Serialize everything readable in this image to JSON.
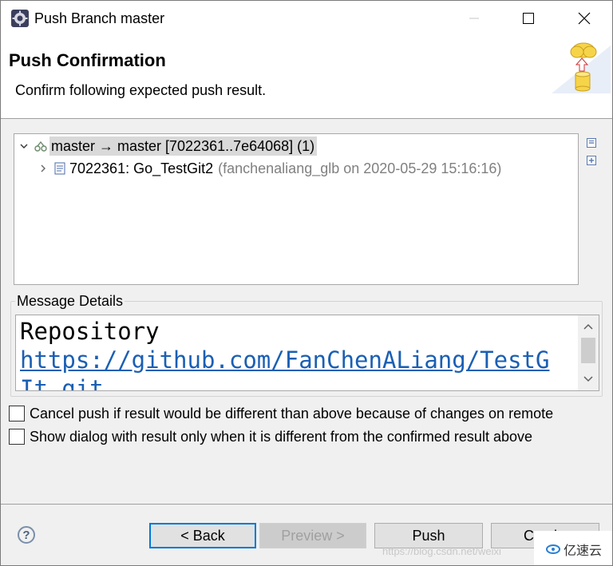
{
  "window": {
    "title": "Push Branch master"
  },
  "header": {
    "title": "Push Confirmation",
    "description": "Confirm following expected push result."
  },
  "tree": {
    "ref_update": "master → master [7022361..7e64068] (1)",
    "commit": {
      "label": "7022361: Go_TestGit2",
      "meta": "(fanchenaliang_glb on 2020-05-29 15:16:16)"
    }
  },
  "message_details": {
    "label": "Message Details",
    "line1": "Repository",
    "line2": "https://github.com/FanChenALiang/TestG",
    "line3": "It.git"
  },
  "options": [
    {
      "label": "Cancel push if result would be different than above because of changes on remote",
      "checked": false
    },
    {
      "label": "Show dialog with result only when it is different from the confirmed result above",
      "checked": false
    }
  ],
  "buttons": {
    "help": "?",
    "back": "< Back",
    "preview": "Preview >",
    "push": "Push",
    "cancel": "Ca...l"
  },
  "watermark": {
    "url": "https://blog.csdn.net/weixi",
    "brand": "亿速云"
  },
  "colors": {
    "accent": "#0078d7",
    "link": "#1a5fb4",
    "selection": "#d9d9d9"
  },
  "icons": {
    "app": "eclipse-gear-icon",
    "wizard": "cloud-push-database-icon",
    "ref": "branch-ref-icon",
    "commit": "commit-icon",
    "collapse_all": "collapse-all-icon",
    "expand_all": "expand-all-icon"
  }
}
